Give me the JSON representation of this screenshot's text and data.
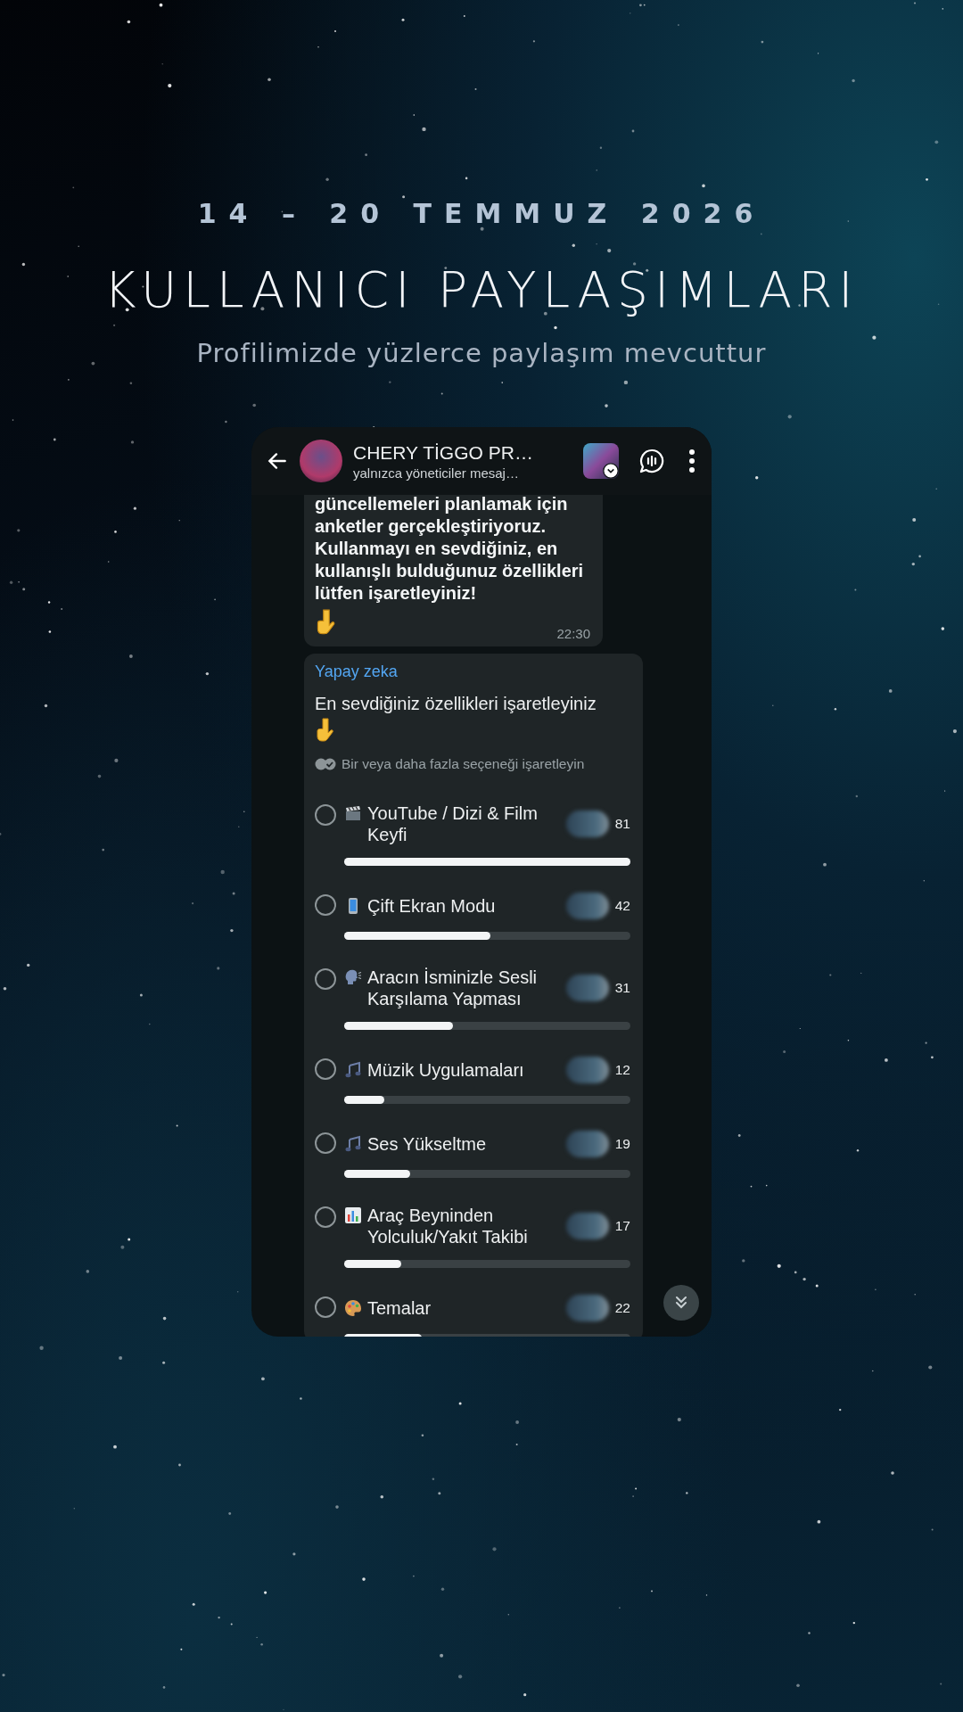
{
  "poster": {
    "date": "14 – 20 TEMMUZ 2026",
    "title": "KULLANICI PAYLAŞIMLARI",
    "subtitle": "Profilimizde yüzlerce paylaşım mevcuttur"
  },
  "chat_header": {
    "name": "CHERY TİGGO PR…",
    "subtitle": "yalnızca yöneticiler mesaj…"
  },
  "message": {
    "text": "güncellemeleri planlamak için anketler gerçekleştiriyoruz. Kullanmayı en sevdiğiniz, en kullanışlı bulduğunuz özellikleri lütfen işaretleyiniz!",
    "time": "22:30"
  },
  "poll": {
    "sender": "Yapay zeka",
    "question": "En sevdiğiniz özellikleri işaretleyiniz",
    "hint": "Bir veya daha fazla seçeneği işaretleyin",
    "options": [
      {
        "label": "YouTube / Dizi & Film Keyfi",
        "count": "81",
        "level": 1.0,
        "selected": false
      },
      {
        "label": "Çift Ekran Modu",
        "count": "42",
        "level": 0.51,
        "selected": false
      },
      {
        "label": "Aracın İsminizle Sesli Karşılama Yapması",
        "count": "31",
        "level": 0.38,
        "selected": false
      },
      {
        "label": "Müzik Uygulamaları",
        "count": "12",
        "level": 0.14,
        "selected": false
      },
      {
        "label": "Ses Yükseltme",
        "count": "19",
        "level": 0.23,
        "selected": false
      },
      {
        "label": "Araç Beyninden Yolculuk/Yakıt Takibi",
        "count": "17",
        "level": 0.2,
        "selected": false
      },
      {
        "label": "Temalar",
        "count": "22",
        "level": 0.27,
        "selected": false
      }
    ]
  }
}
